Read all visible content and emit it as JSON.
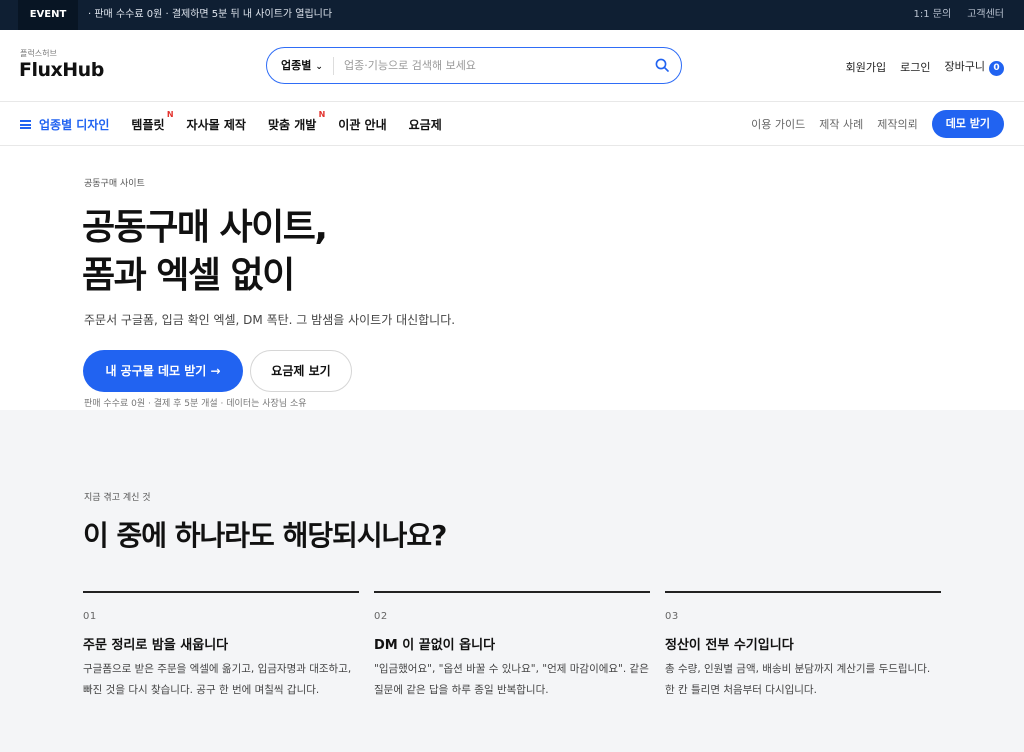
{
  "eventbar": {
    "tag": "EVENT",
    "message": "· 판매 수수료 0원 · 결제하면 5분 뒤 내 사이트가 열립니다",
    "links": [
      "1:1 문의",
      "고객센터"
    ]
  },
  "header": {
    "logo_sub": "플럭스허브",
    "logo": "FluxHub",
    "search": {
      "category": "업종별",
      "placeholder": "업종·기능으로 검색해 보세요"
    },
    "signup": "회원가입",
    "login": "로그인",
    "cart": "장바구니",
    "cart_count": "0"
  },
  "nav": {
    "primary": "업종별 디자인",
    "items": [
      {
        "label": "템플릿",
        "badge": "N"
      },
      {
        "label": "자사몰 제작",
        "badge": ""
      },
      {
        "label": "맞춤 개발",
        "badge": "N"
      },
      {
        "label": "이관 안내",
        "badge": ""
      },
      {
        "label": "요금제",
        "badge": ""
      }
    ],
    "right_links": [
      "이용 가이드",
      "제작 사례",
      "제작의뢰"
    ],
    "demo_button": "데모 받기"
  },
  "hero": {
    "eyebrow": "공동구매 사이트",
    "title_line1": "공동구매 사이트,",
    "title_line2": "폼과 엑셀 없이",
    "subtitle": "주문서 구글폼, 입금 확인 엑셀, DM 폭탄. 그 밤샘을 사이트가 대신합니다.",
    "primary_button": "내 공구몰 데모 받기 →",
    "secondary_button": "요금제 보기",
    "note": "판매 수수료 0원 · 결제 후 5분 개설 · 데이터는 사장님 소유"
  },
  "section": {
    "eyebrow": "지금 겪고 계신 것",
    "title": "이 중에 하나라도 해당되시나요?",
    "cards": [
      {
        "num": "01",
        "title": "주문 정리로 밤을 새웁니다",
        "body": "구글폼으로 받은 주문을 엑셀에 옮기고, 입금자명과 대조하고, 빠진 것을 다시 찾습니다. 공구 한 번에 며칠씩 갑니다."
      },
      {
        "num": "02",
        "title": "DM 이 끝없이 옵니다",
        "body": "\"입금했어요\", \"옵션 바꿀 수 있나요\", \"언제 마감이에요\". 같은 질문에 같은 답을 하루 종일 반복합니다."
      },
      {
        "num": "03",
        "title": "정산이 전부 수기입니다",
        "body": "총 수량, 인원별 금액, 배송비 분담까지 계산기를 두드립니다. 한 칸 틀리면 처음부터 다시입니다."
      }
    ]
  },
  "colors": {
    "accent": "#2163f1",
    "eventbar": "#0f1f33",
    "section_bg": "#f4f5f7",
    "new_badge": "#e3342f"
  }
}
